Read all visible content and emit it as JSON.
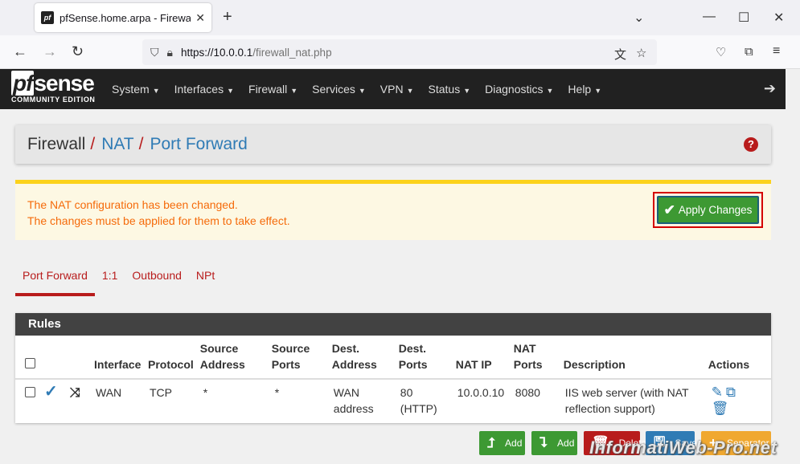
{
  "browser": {
    "tab_title": "pfSense.home.arpa - Firewall: N",
    "favicon_text": "pf",
    "close_glyph": "✕",
    "new_tab_glyph": "+",
    "url_host": "https://10.0.0.1",
    "url_path": "/firewall_nat.php"
  },
  "brand": {
    "logo_pf": "pf",
    "logo_rest": "sense",
    "logo_sub": "COMMUNITY EDITION"
  },
  "menu": [
    {
      "label": "System"
    },
    {
      "label": "Interfaces"
    },
    {
      "label": "Firewall"
    },
    {
      "label": "Services"
    },
    {
      "label": "VPN"
    },
    {
      "label": "Status"
    },
    {
      "label": "Diagnostics"
    },
    {
      "label": "Help"
    }
  ],
  "breadcrumb": {
    "first": "Firewall",
    "sep": "/",
    "second": "NAT",
    "third": "Port Forward",
    "help": "?"
  },
  "alert": {
    "line1": "The NAT configuration has been changed.",
    "line2": "The changes must be applied for them to take effect.",
    "apply_label": "Apply Changes"
  },
  "tabs": [
    {
      "label": "Port Forward",
      "active": true
    },
    {
      "label": "1:1",
      "active": false
    },
    {
      "label": "Outbound",
      "active": false
    },
    {
      "label": "NPt",
      "active": false
    }
  ],
  "rules": {
    "title": "Rules",
    "headers": {
      "interface": "Interface",
      "protocol": "Protocol",
      "source_address_1": "Source",
      "source_address_2": "Address",
      "source_ports_1": "Source",
      "source_ports_2": "Ports",
      "dest_address_1": "Dest.",
      "dest_address_2": "Address",
      "dest_ports_1": "Dest.",
      "dest_ports_2": "Ports",
      "nat_ip": "NAT IP",
      "nat_ports_1": "NAT",
      "nat_ports_2": "Ports",
      "description": "Description",
      "actions": "Actions"
    },
    "rows": [
      {
        "interface": "WAN",
        "protocol": "TCP",
        "source_address": "*",
        "source_ports": "*",
        "dest_address_1": "WAN",
        "dest_address_2": "address",
        "dest_ports_1": "80",
        "dest_ports_2": "(HTTP)",
        "nat_ip": "10.0.0.10",
        "nat_ports": "8080",
        "description_1": "IIS web server (with NAT",
        "description_2": "reflection support)"
      }
    ]
  },
  "buttons": {
    "add_top": "Add",
    "add_bottom": "Add",
    "delete": "Delete",
    "save": "Save",
    "separator": "Separator"
  },
  "watermark": "InformatiWeb-Pro.net",
  "colors": {
    "accent_red": "#b81c1c",
    "link_blue": "#2f7bb5",
    "success_green": "#3d9933",
    "warning_orange": "#f56b0b",
    "nav_dark": "#212121"
  }
}
